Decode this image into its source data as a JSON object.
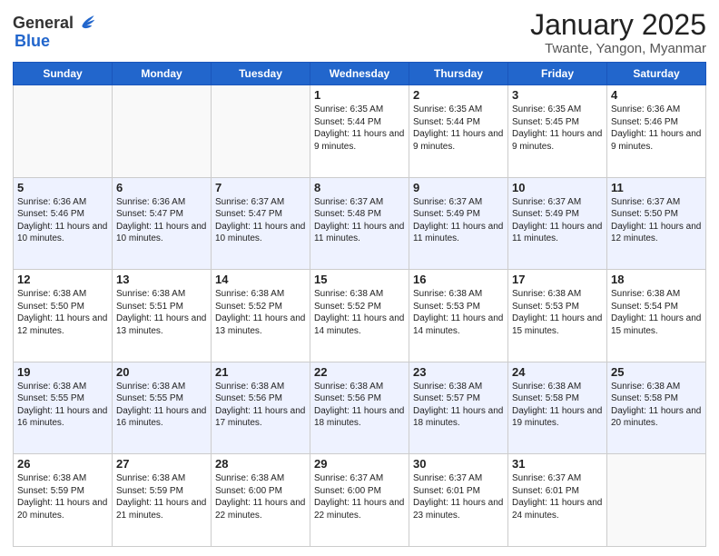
{
  "header": {
    "logo_general": "General",
    "logo_blue": "Blue",
    "month_title": "January 2025",
    "location": "Twante, Yangon, Myanmar"
  },
  "weekdays": [
    "Sunday",
    "Monday",
    "Tuesday",
    "Wednesday",
    "Thursday",
    "Friday",
    "Saturday"
  ],
  "weeks": [
    [
      {
        "day": "",
        "text": ""
      },
      {
        "day": "",
        "text": ""
      },
      {
        "day": "",
        "text": ""
      },
      {
        "day": "1",
        "text": "Sunrise: 6:35 AM\nSunset: 5:44 PM\nDaylight: 11 hours and 9 minutes."
      },
      {
        "day": "2",
        "text": "Sunrise: 6:35 AM\nSunset: 5:44 PM\nDaylight: 11 hours and 9 minutes."
      },
      {
        "day": "3",
        "text": "Sunrise: 6:35 AM\nSunset: 5:45 PM\nDaylight: 11 hours and 9 minutes."
      },
      {
        "day": "4",
        "text": "Sunrise: 6:36 AM\nSunset: 5:46 PM\nDaylight: 11 hours and 9 minutes."
      }
    ],
    [
      {
        "day": "5",
        "text": "Sunrise: 6:36 AM\nSunset: 5:46 PM\nDaylight: 11 hours and 10 minutes."
      },
      {
        "day": "6",
        "text": "Sunrise: 6:36 AM\nSunset: 5:47 PM\nDaylight: 11 hours and 10 minutes."
      },
      {
        "day": "7",
        "text": "Sunrise: 6:37 AM\nSunset: 5:47 PM\nDaylight: 11 hours and 10 minutes."
      },
      {
        "day": "8",
        "text": "Sunrise: 6:37 AM\nSunset: 5:48 PM\nDaylight: 11 hours and 11 minutes."
      },
      {
        "day": "9",
        "text": "Sunrise: 6:37 AM\nSunset: 5:49 PM\nDaylight: 11 hours and 11 minutes."
      },
      {
        "day": "10",
        "text": "Sunrise: 6:37 AM\nSunset: 5:49 PM\nDaylight: 11 hours and 11 minutes."
      },
      {
        "day": "11",
        "text": "Sunrise: 6:37 AM\nSunset: 5:50 PM\nDaylight: 11 hours and 12 minutes."
      }
    ],
    [
      {
        "day": "12",
        "text": "Sunrise: 6:38 AM\nSunset: 5:50 PM\nDaylight: 11 hours and 12 minutes."
      },
      {
        "day": "13",
        "text": "Sunrise: 6:38 AM\nSunset: 5:51 PM\nDaylight: 11 hours and 13 minutes."
      },
      {
        "day": "14",
        "text": "Sunrise: 6:38 AM\nSunset: 5:52 PM\nDaylight: 11 hours and 13 minutes."
      },
      {
        "day": "15",
        "text": "Sunrise: 6:38 AM\nSunset: 5:52 PM\nDaylight: 11 hours and 14 minutes."
      },
      {
        "day": "16",
        "text": "Sunrise: 6:38 AM\nSunset: 5:53 PM\nDaylight: 11 hours and 14 minutes."
      },
      {
        "day": "17",
        "text": "Sunrise: 6:38 AM\nSunset: 5:53 PM\nDaylight: 11 hours and 15 minutes."
      },
      {
        "day": "18",
        "text": "Sunrise: 6:38 AM\nSunset: 5:54 PM\nDaylight: 11 hours and 15 minutes."
      }
    ],
    [
      {
        "day": "19",
        "text": "Sunrise: 6:38 AM\nSunset: 5:55 PM\nDaylight: 11 hours and 16 minutes."
      },
      {
        "day": "20",
        "text": "Sunrise: 6:38 AM\nSunset: 5:55 PM\nDaylight: 11 hours and 16 minutes."
      },
      {
        "day": "21",
        "text": "Sunrise: 6:38 AM\nSunset: 5:56 PM\nDaylight: 11 hours and 17 minutes."
      },
      {
        "day": "22",
        "text": "Sunrise: 6:38 AM\nSunset: 5:56 PM\nDaylight: 11 hours and 18 minutes."
      },
      {
        "day": "23",
        "text": "Sunrise: 6:38 AM\nSunset: 5:57 PM\nDaylight: 11 hours and 18 minutes."
      },
      {
        "day": "24",
        "text": "Sunrise: 6:38 AM\nSunset: 5:58 PM\nDaylight: 11 hours and 19 minutes."
      },
      {
        "day": "25",
        "text": "Sunrise: 6:38 AM\nSunset: 5:58 PM\nDaylight: 11 hours and 20 minutes."
      }
    ],
    [
      {
        "day": "26",
        "text": "Sunrise: 6:38 AM\nSunset: 5:59 PM\nDaylight: 11 hours and 20 minutes."
      },
      {
        "day": "27",
        "text": "Sunrise: 6:38 AM\nSunset: 5:59 PM\nDaylight: 11 hours and 21 minutes."
      },
      {
        "day": "28",
        "text": "Sunrise: 6:38 AM\nSunset: 6:00 PM\nDaylight: 11 hours and 22 minutes."
      },
      {
        "day": "29",
        "text": "Sunrise: 6:37 AM\nSunset: 6:00 PM\nDaylight: 11 hours and 22 minutes."
      },
      {
        "day": "30",
        "text": "Sunrise: 6:37 AM\nSunset: 6:01 PM\nDaylight: 11 hours and 23 minutes."
      },
      {
        "day": "31",
        "text": "Sunrise: 6:37 AM\nSunset: 6:01 PM\nDaylight: 11 hours and 24 minutes."
      },
      {
        "day": "",
        "text": ""
      }
    ]
  ]
}
